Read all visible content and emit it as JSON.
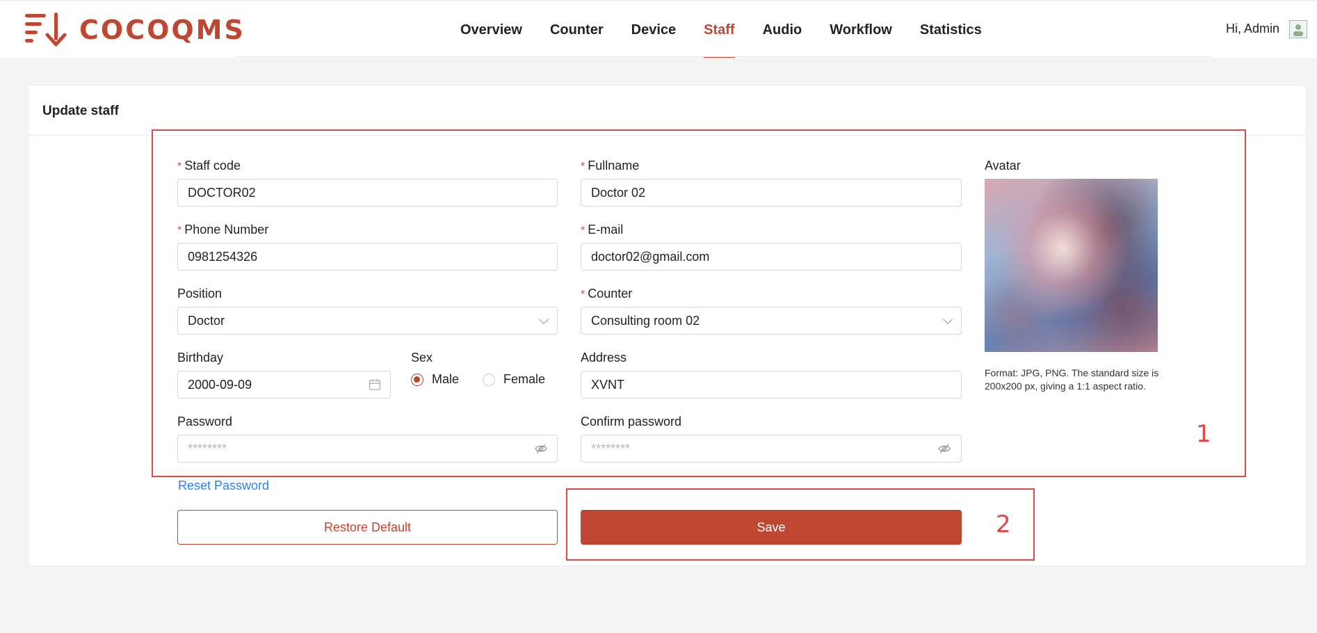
{
  "header": {
    "logo_text": "COCOQMS",
    "nav": [
      {
        "label": "Overview"
      },
      {
        "label": "Counter"
      },
      {
        "label": "Device"
      },
      {
        "label": "Staff",
        "active": true
      },
      {
        "label": "Audio"
      },
      {
        "label": "Workflow"
      },
      {
        "label": "Statistics"
      }
    ],
    "greeting": "Hi, Admin",
    "brand_color": "#bf4630"
  },
  "card": {
    "title": "Update staff"
  },
  "form": {
    "staff_code": {
      "label": "Staff code",
      "value": "DOCTOR02",
      "required": "*"
    },
    "fullname": {
      "label": "Fullname",
      "value": "Doctor 02",
      "required": "*"
    },
    "phone": {
      "label": "Phone Number",
      "value": "0981254326",
      "required": "*"
    },
    "email": {
      "label": "E-mail",
      "value": "doctor02@gmail.com",
      "required": "*"
    },
    "position": {
      "label": "Position",
      "value": "Doctor"
    },
    "counter": {
      "label": "Counter",
      "value": "Consulting room 02",
      "required": "*"
    },
    "birthday": {
      "label": "Birthday",
      "value": "2000-09-09"
    },
    "sex": {
      "label": "Sex",
      "options": [
        "Male",
        "Female"
      ],
      "selected": "Male"
    },
    "address": {
      "label": "Address",
      "value": "XVNT"
    },
    "password": {
      "label": "Password",
      "placeholder": "********"
    },
    "confirm_password": {
      "label": "Confirm password",
      "placeholder": "********"
    }
  },
  "avatar": {
    "label": "Avatar",
    "hint": "Format: JPG, PNG. The standard size is 200x200 px, giving a 1:1 aspect ratio."
  },
  "actions": {
    "reset_password": "Reset Password",
    "restore_default": "Restore Default",
    "save": "Save"
  },
  "annotations": {
    "box1_label": "1",
    "box2_label": "2",
    "color": "#e04848"
  }
}
